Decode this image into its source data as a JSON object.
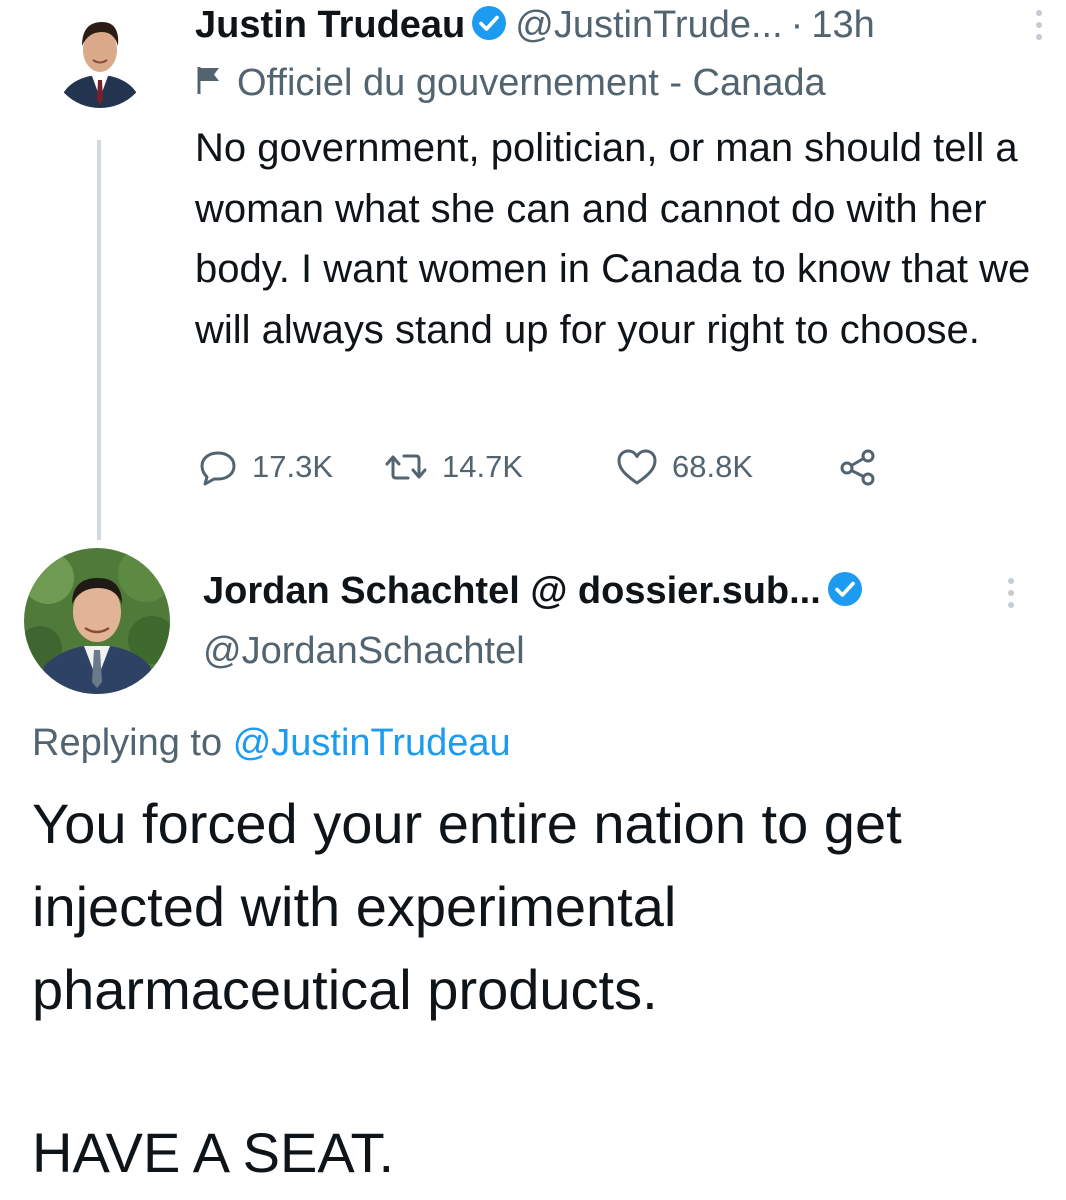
{
  "tweet": {
    "author_name": "Justin Trudeau",
    "handle": "@JustinTrude...",
    "separator": "·",
    "timestamp": "13h",
    "label": "Officiel du gouvernement - Canada",
    "text": "No government, politician, or man should tell a woman what she can and cannot do with her body. I want women in Canada to know that we will always stand up for your right to choose.",
    "replies": "17.3K",
    "retweets": "14.7K",
    "likes": "68.8K"
  },
  "reply": {
    "author_name": "Jordan Schachtel @ dossier.sub...",
    "handle": "@JordanSchachtel",
    "replying_prefix": "Replying to",
    "replying_to": "@JustinTrudeau",
    "text": "You forced your entire nation to get injected with experimental pharmaceutical products.",
    "closing": "HAVE A SEAT."
  },
  "colors": {
    "text": "#0f1419",
    "secondary": "#536471",
    "accent": "#1d9bf0",
    "thread_line": "#cfd9de"
  },
  "icons": [
    "verified-badge-icon",
    "more-options-icon",
    "government-flag-icon",
    "reply-icon",
    "retweet-icon",
    "like-icon",
    "share-icon"
  ]
}
